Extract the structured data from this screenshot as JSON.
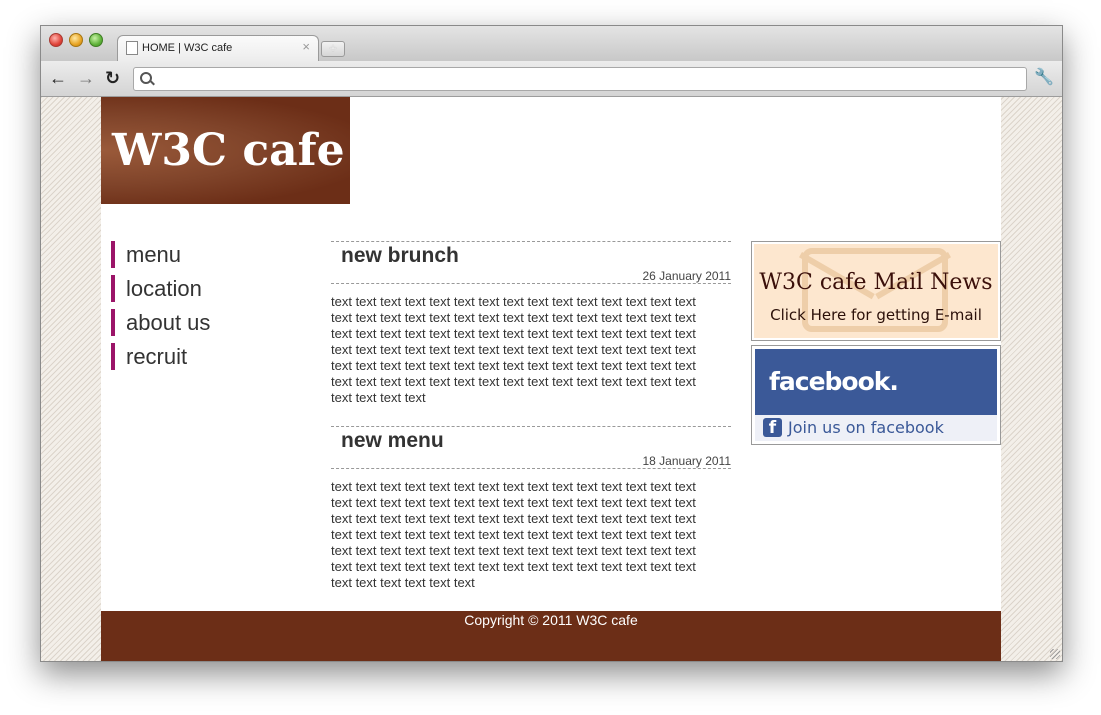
{
  "browser": {
    "tab_title": "HOME | W3C cafe",
    "tab_close": "×",
    "newtab": "+",
    "address": {
      "value": "",
      "placeholder": ""
    },
    "nav": {
      "back": "←",
      "forward": "→",
      "reload": "↻",
      "wrench": "🔧"
    }
  },
  "site": {
    "logo_text": "W3C cafe",
    "nav_items": [
      "menu",
      "location",
      "about us",
      "recruit"
    ],
    "articles": [
      {
        "title": "new brunch",
        "date": "26 January 2011",
        "body": "text text text text text text text text text text text text text text text text text text text text text text text text text text text text text text text text text text text text text text text text text text text text text text text text text text text text text text text text text text text text text text text text text text text text text text text text text text text text text text text text text text text text text text text text text text text text text text"
      },
      {
        "title": "new menu",
        "date": "18 January 2011",
        "body": "text text text text text text text text text text text text text text text text text text text text text text text text text text text text text text text text text text text text text text text text text text text text text text text text text text text text text text text text text text text text text text text text text text text text text text text text text text text text text text text text text text text text text text text text text text text text text text text text"
      }
    ],
    "mail_news": {
      "title": "W3C cafe Mail News",
      "subtitle": "Click Here for getting E-mail"
    },
    "facebook": {
      "wordmark": "facebook.",
      "f_glyph": "f",
      "join": "Join us on facebook"
    },
    "footer": "Copyright © 2011 W3C cafe"
  },
  "colors": {
    "brand_brown": "#6c2e17",
    "nav_accent": "#9b1468",
    "facebook_blue": "#3b5998",
    "mail_bg": "#fde7cf"
  }
}
